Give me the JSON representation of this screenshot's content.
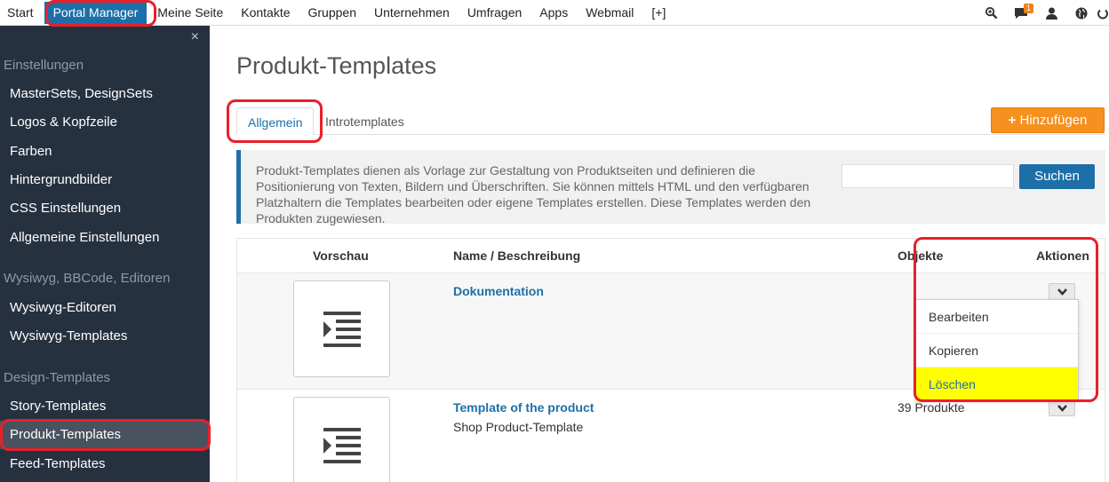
{
  "nav": {
    "items": [
      "Start",
      "Portal Manager",
      "Meine Seite",
      "Kontakte",
      "Gruppen",
      "Unternehmen",
      "Umfragen",
      "Apps",
      "Webmail",
      "[+]"
    ],
    "icons": [
      "zoom-icon",
      "chat-icon",
      "user-icon",
      "globe-icon",
      "power-icon"
    ],
    "notification_count": "1"
  },
  "sidebar": {
    "close": "×",
    "sections": {
      "einstellungen": "Einstellungen",
      "wysiwyg": "Wysiwyg, BBCode, Editoren",
      "design": "Design-Templates"
    },
    "items": {
      "mastersets": "MasterSets, DesignSets",
      "logos": "Logos & Kopfzeile",
      "farben": "Farben",
      "hintergrund": "Hintergrundbilder",
      "css": "CSS Einstellungen",
      "allgemeine": "Allgemeine Einstellungen",
      "wysiwyg_editoren": "Wysiwyg-Editoren",
      "wysiwyg_templates": "Wysiwyg-Templates",
      "story": "Story-Templates",
      "produkt": "Produkt-Templates",
      "feed": "Feed-Templates"
    }
  },
  "main": {
    "title": "Produkt-Templates",
    "tabs": {
      "allgemein": "Allgemein",
      "intro": "Introtemplates"
    },
    "add_button": "Hinzufügen",
    "info": "Produkt-Templates dienen als Vorlage zur Gestaltung von Produktseiten und definieren die Positionierung von Texten, Bildern und Überschriften. Sie können mittels HTML und den verfügbaren Platzhaltern die Templates bearbeiten oder eigene Templates erstellen. Diese Templates werden den Produkten zugewiesen.",
    "search_value": "",
    "search_button": "Suchen"
  },
  "table": {
    "headers": {
      "vorschau": "Vorschau",
      "name": "Name / Beschreibung",
      "objekte": "Objekte",
      "aktionen": "Aktionen"
    },
    "rows": [
      {
        "name": "Dokumentation",
        "description": "",
        "count": ""
      },
      {
        "name": "Template of the product",
        "description": "Shop Product-Template",
        "count": "39 Produkte"
      }
    ]
  },
  "dropdown": {
    "edit": "Bearbeiten",
    "copy": "Kopieren",
    "delete": "Löschen"
  },
  "colors": {
    "brand_blue": "#1d6fa8",
    "sidebar_bg": "#263140",
    "add_orange": "#f6901e",
    "highlight_yellow": "#ffff00",
    "annotation_red": "#e8202a"
  }
}
